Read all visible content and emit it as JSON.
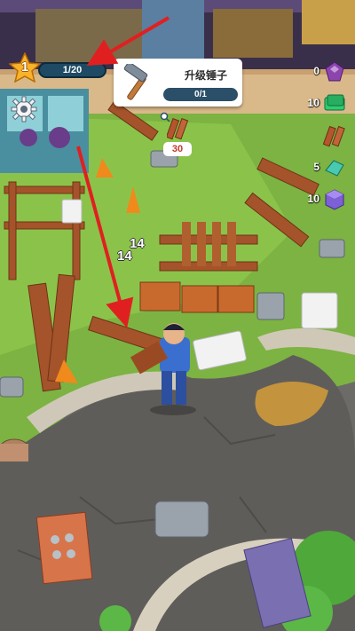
{
  "hud": {
    "level": "1",
    "xp_text": "1/20"
  },
  "task": {
    "icon": "hammer-icon",
    "title": "升级锤子",
    "progress_text": "0/1"
  },
  "plank_requirement": {
    "icon": "wood-plank-icon",
    "count": "30"
  },
  "resources": [
    {
      "icon": "purple-gem-icon",
      "count": "0",
      "color": "#8e44ad"
    },
    {
      "icon": "green-cash-icon",
      "count": "10",
      "color": "#2ecc71"
    },
    {
      "icon": "wood-plank-icon",
      "count": "",
      "color": "#b5552e"
    },
    {
      "icon": "teal-crystal-icon",
      "count": "5",
      "color": "#48c9b0"
    },
    {
      "icon": "purple-block-icon",
      "count": "10",
      "color": "#7d5fd6"
    }
  ],
  "floating_numbers": [
    "14",
    "14"
  ],
  "annotation_arrow_color": "#e02020"
}
